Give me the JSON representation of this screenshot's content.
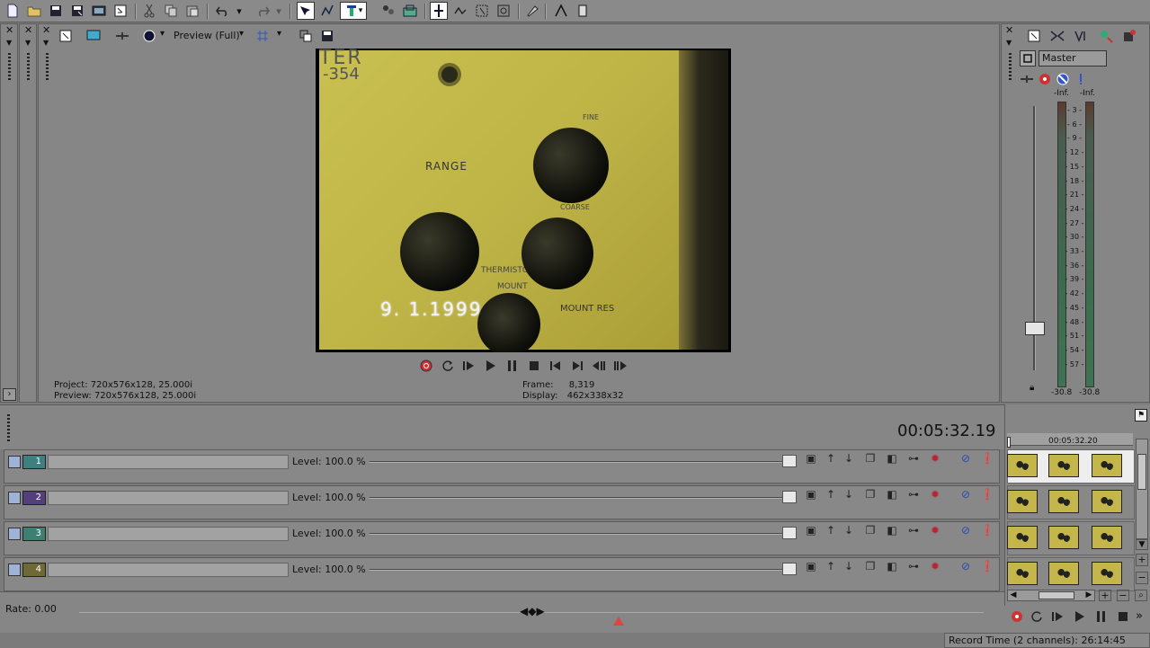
{
  "toolbar": {
    "icons": [
      "new-file-icon",
      "open-folder-icon",
      "save-icon",
      "save-as-icon",
      "render-icon",
      "properties-icon",
      "cut-icon",
      "copy-icon",
      "paste-icon",
      "undo-icon",
      "redo-icon",
      "normal-edit-tool-icon",
      "envelope-tool-icon",
      "snap-icon",
      "auto-ripple-icon",
      "lock-envelopes-icon",
      "enable-snapping-icon",
      "ignore-event-grouping-icon",
      "selection-tool-icon",
      "zoom-tool-icon",
      "paint-icon",
      "split-icon"
    ]
  },
  "preview": {
    "quality_label": "Preview (Full)",
    "video_overlay_date": "9. 1.1999",
    "video_text_range": "RANGE",
    "video_text_fine": "FINE",
    "video_text_coarse": "COARSE",
    "video_text_mount": "MOUNT",
    "video_text_mount_res": "MOUNT RES",
    "video_text_thermistor": "THERMISTOR",
    "video_text_model": "-354",
    "video_text_meter": "TER",
    "info": {
      "project_label": "Project:",
      "project_value": "720x576x128, 25.000i",
      "preview_label": "Preview:",
      "preview_value": "720x576x128, 25.000i",
      "frame_label": "Frame:",
      "frame_value": "8,319",
      "display_label": "Display:",
      "display_value": "462x338x32"
    }
  },
  "mixer": {
    "master_label": "Master",
    "peak_left": "-Inf.",
    "peak_right": "-Inf.",
    "scale": [
      "3",
      "6",
      "9",
      "12",
      "15",
      "18",
      "21",
      "24",
      "27",
      "30",
      "33",
      "36",
      "39",
      "42",
      "45",
      "48",
      "51",
      "54",
      "57"
    ],
    "bottom_left": "-30.8",
    "bottom_right": "-30.8",
    "fader_level_db": 0
  },
  "timeline": {
    "timecode": "00:05:32.19",
    "ruler_time": "00:05:32.20",
    "tracks": [
      {
        "number": "1",
        "level": "Level: 100.0 %",
        "color": "#3f7f80"
      },
      {
        "number": "2",
        "level": "Level: 100.0 %",
        "color": "#53407a"
      },
      {
        "number": "3",
        "level": "Level: 100.0 %",
        "color": "#3f7f72"
      },
      {
        "number": "4",
        "level": "Level: 100.0 %",
        "color": "#6f6a35"
      }
    ],
    "rate_label": "Rate: 0.00"
  },
  "status": {
    "record_time": "Record Time (2 channels): 26:14:45"
  }
}
